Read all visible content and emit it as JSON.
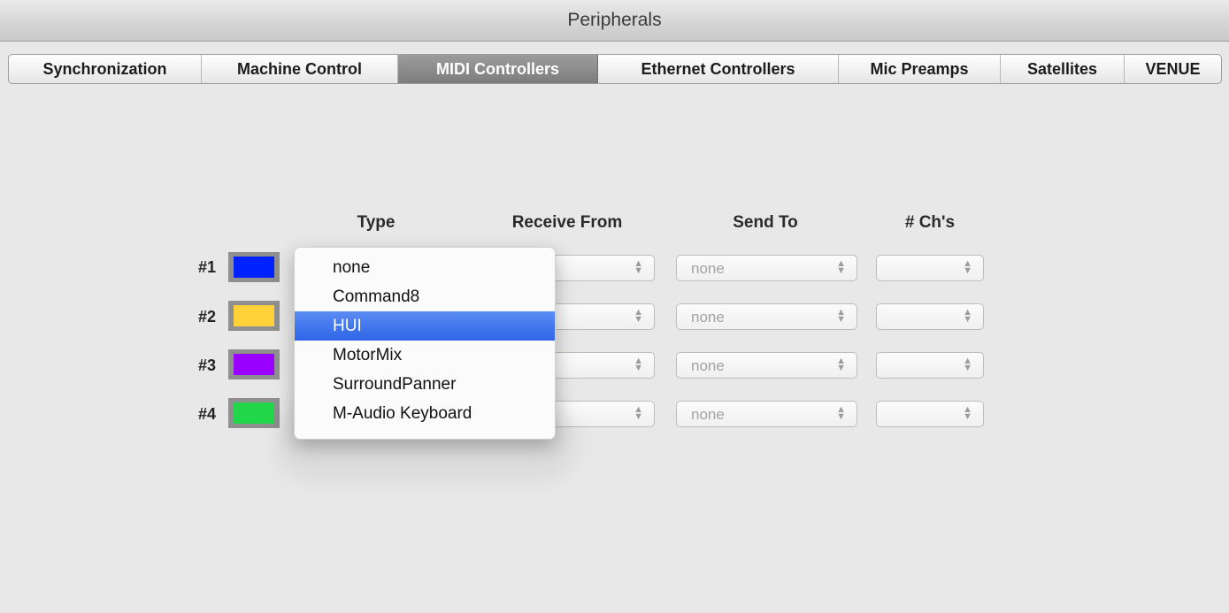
{
  "window": {
    "title": "Peripherals"
  },
  "tabs": [
    {
      "label": "Synchronization",
      "active": false
    },
    {
      "label": "Machine Control",
      "active": false
    },
    {
      "label": "MIDI Controllers",
      "active": true
    },
    {
      "label": "Ethernet Controllers",
      "active": false
    },
    {
      "label": "Mic Preamps",
      "active": false
    },
    {
      "label": "Satellites",
      "active": false
    },
    {
      "label": "VENUE",
      "active": false
    }
  ],
  "columns": {
    "type": "Type",
    "receive_from": "Receive From",
    "send_to": "Send To",
    "channels": "# Ch's"
  },
  "controllers": [
    {
      "label": "#1",
      "color": "#0022ff",
      "receive_from": "",
      "send_to": "none",
      "channels": ""
    },
    {
      "label": "#2",
      "color": "#ffd23a",
      "receive_from": "",
      "send_to": "none",
      "channels": ""
    },
    {
      "label": "#3",
      "color": "#9a00ff",
      "receive_from": "",
      "send_to": "none",
      "channels": ""
    },
    {
      "label": "#4",
      "color": "#22d84a",
      "receive_from": "",
      "send_to": "none",
      "channels": ""
    }
  ],
  "type_menu": {
    "options": [
      "none",
      "Command8",
      "HUI",
      "MotorMix",
      "SurroundPanner",
      "M-Audio Keyboard"
    ],
    "highlighted": "HUI"
  },
  "icons": {
    "popup_arrows": "up-down-chevron-icon"
  }
}
